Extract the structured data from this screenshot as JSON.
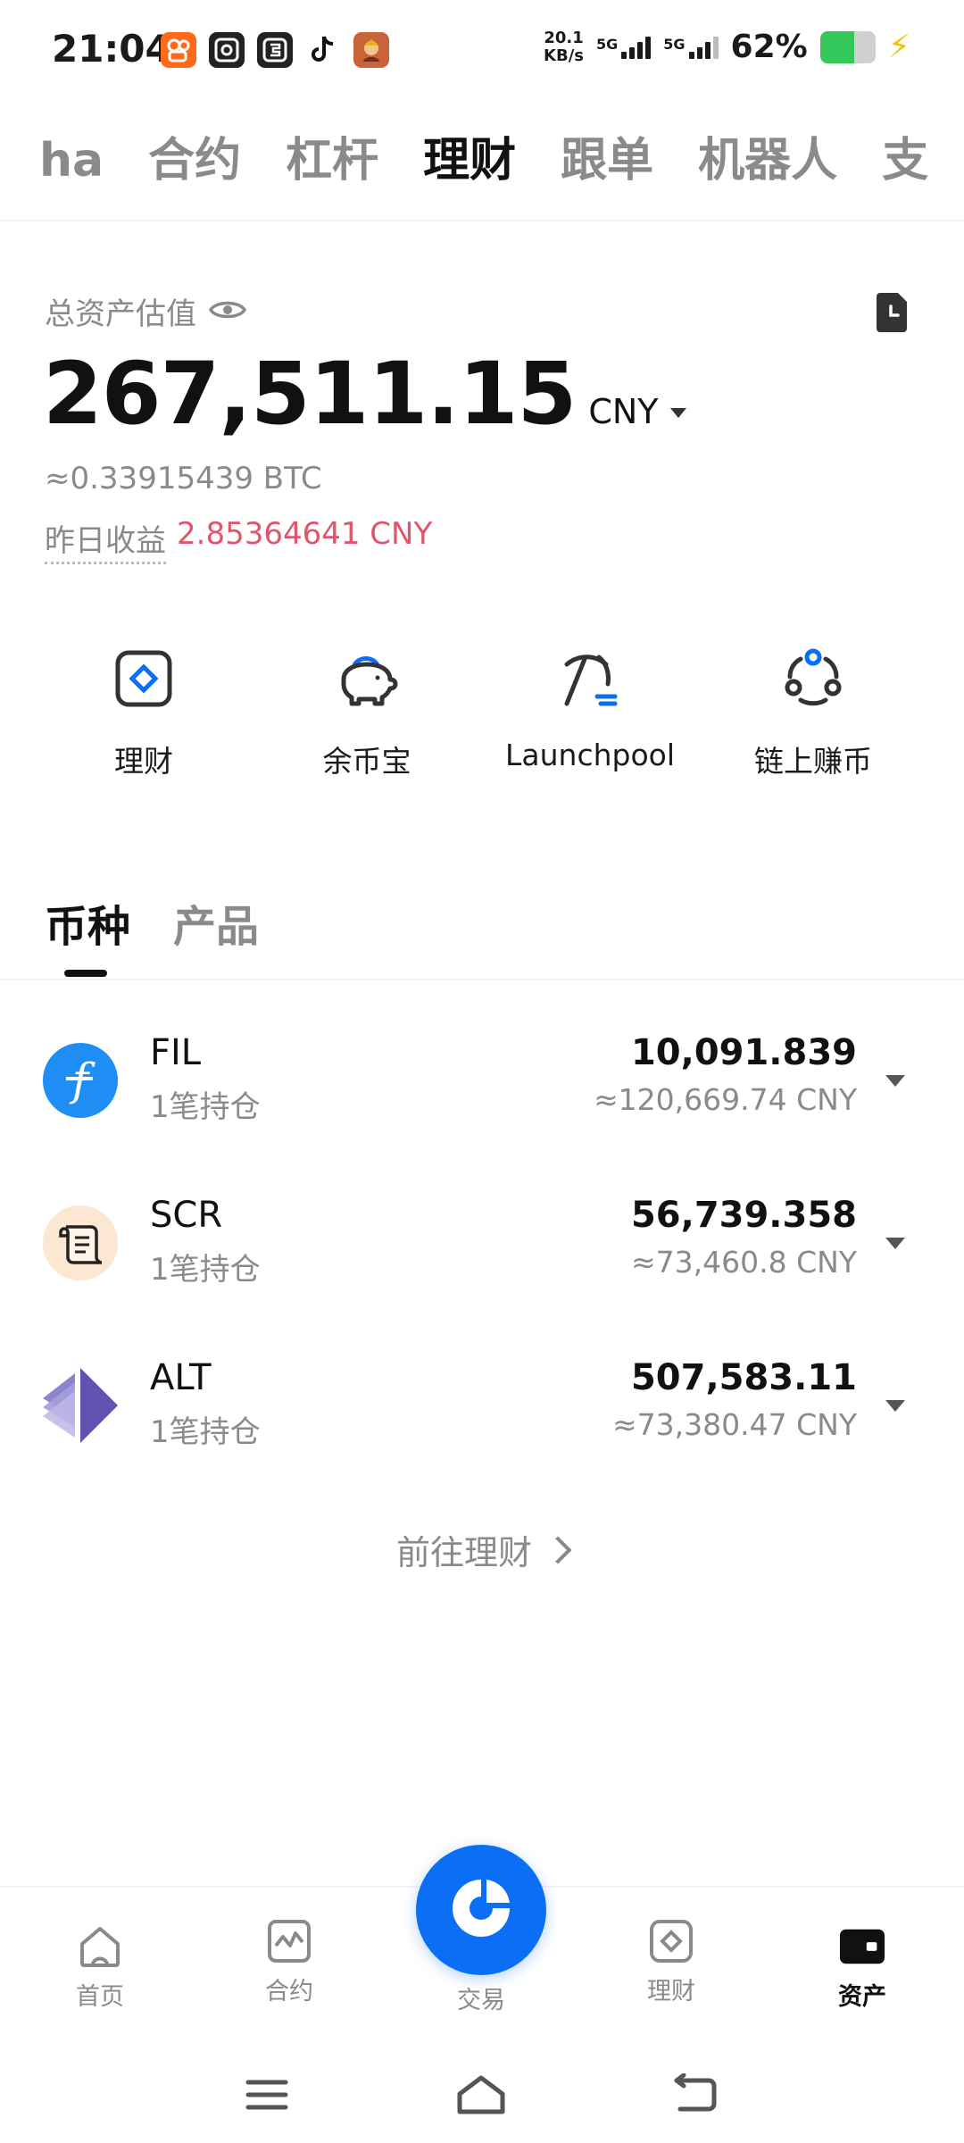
{
  "status_bar": {
    "time": "21:04",
    "net_speed_value": "20.1",
    "net_speed_unit": "KB/s",
    "sim1_label": "5G",
    "sim2_label": "5G",
    "battery_percent": "62%",
    "battery_level": 0.62,
    "notification_icons": [
      "kuaishou-icon",
      "browser-icon",
      "app-icon",
      "tiktok-icon",
      "game-icon"
    ]
  },
  "top_tabs": {
    "items": [
      "ha",
      "合约",
      "杠杆",
      "理财",
      "跟单",
      "机器人",
      "支"
    ],
    "active": "理财"
  },
  "asset_summary": {
    "label": "总资产估值",
    "total_value": "267,511.15",
    "currency": "CNY",
    "btc_equivalent": "≈0.33915439 BTC",
    "yesterday_label": "昨日收益",
    "yesterday_value": "2.85364641 CNY"
  },
  "quick_actions": [
    {
      "label": "理财",
      "icon": "finance-icon"
    },
    {
      "label": "余币宝",
      "icon": "piggy-bank-icon"
    },
    {
      "label": "Launchpool",
      "icon": "pickaxe-icon"
    },
    {
      "label": "链上赚币",
      "icon": "onchain-earn-icon"
    }
  ],
  "sub_tabs": {
    "items": [
      "币种",
      "产品"
    ],
    "active": "币种"
  },
  "holdings": [
    {
      "symbol": "FIL",
      "positions": "1笔持仓",
      "amount": "10,091.839",
      "value": "≈120,669.74 CNY",
      "icon": "fil-coin-icon",
      "icon_color": "#1e8ef5"
    },
    {
      "symbol": "SCR",
      "positions": "1笔持仓",
      "amount": "56,739.358",
      "value": "≈73,460.8 CNY",
      "icon": "scroll-coin-icon",
      "icon_color": "#fbe7d2"
    },
    {
      "symbol": "ALT",
      "positions": "1笔持仓",
      "amount": "507,583.11",
      "value": "≈73,380.47 CNY",
      "icon": "altlayer-coin-icon",
      "icon_color": "#6b5fb6"
    }
  ],
  "goto_link": "前往理财",
  "bottom_nav": {
    "items": [
      {
        "label": "首页",
        "icon": "home-icon"
      },
      {
        "label": "合约",
        "icon": "futures-chart-icon"
      },
      {
        "label": "交易",
        "icon": "trade-icon"
      },
      {
        "label": "理财",
        "icon": "finance-icon"
      },
      {
        "label": "资产",
        "icon": "wallet-icon"
      }
    ],
    "active": "资产"
  },
  "colors": {
    "accent_blue": "#0a6ff4",
    "profit_red": "#e0556c",
    "muted_text": "#8a8a8a"
  }
}
